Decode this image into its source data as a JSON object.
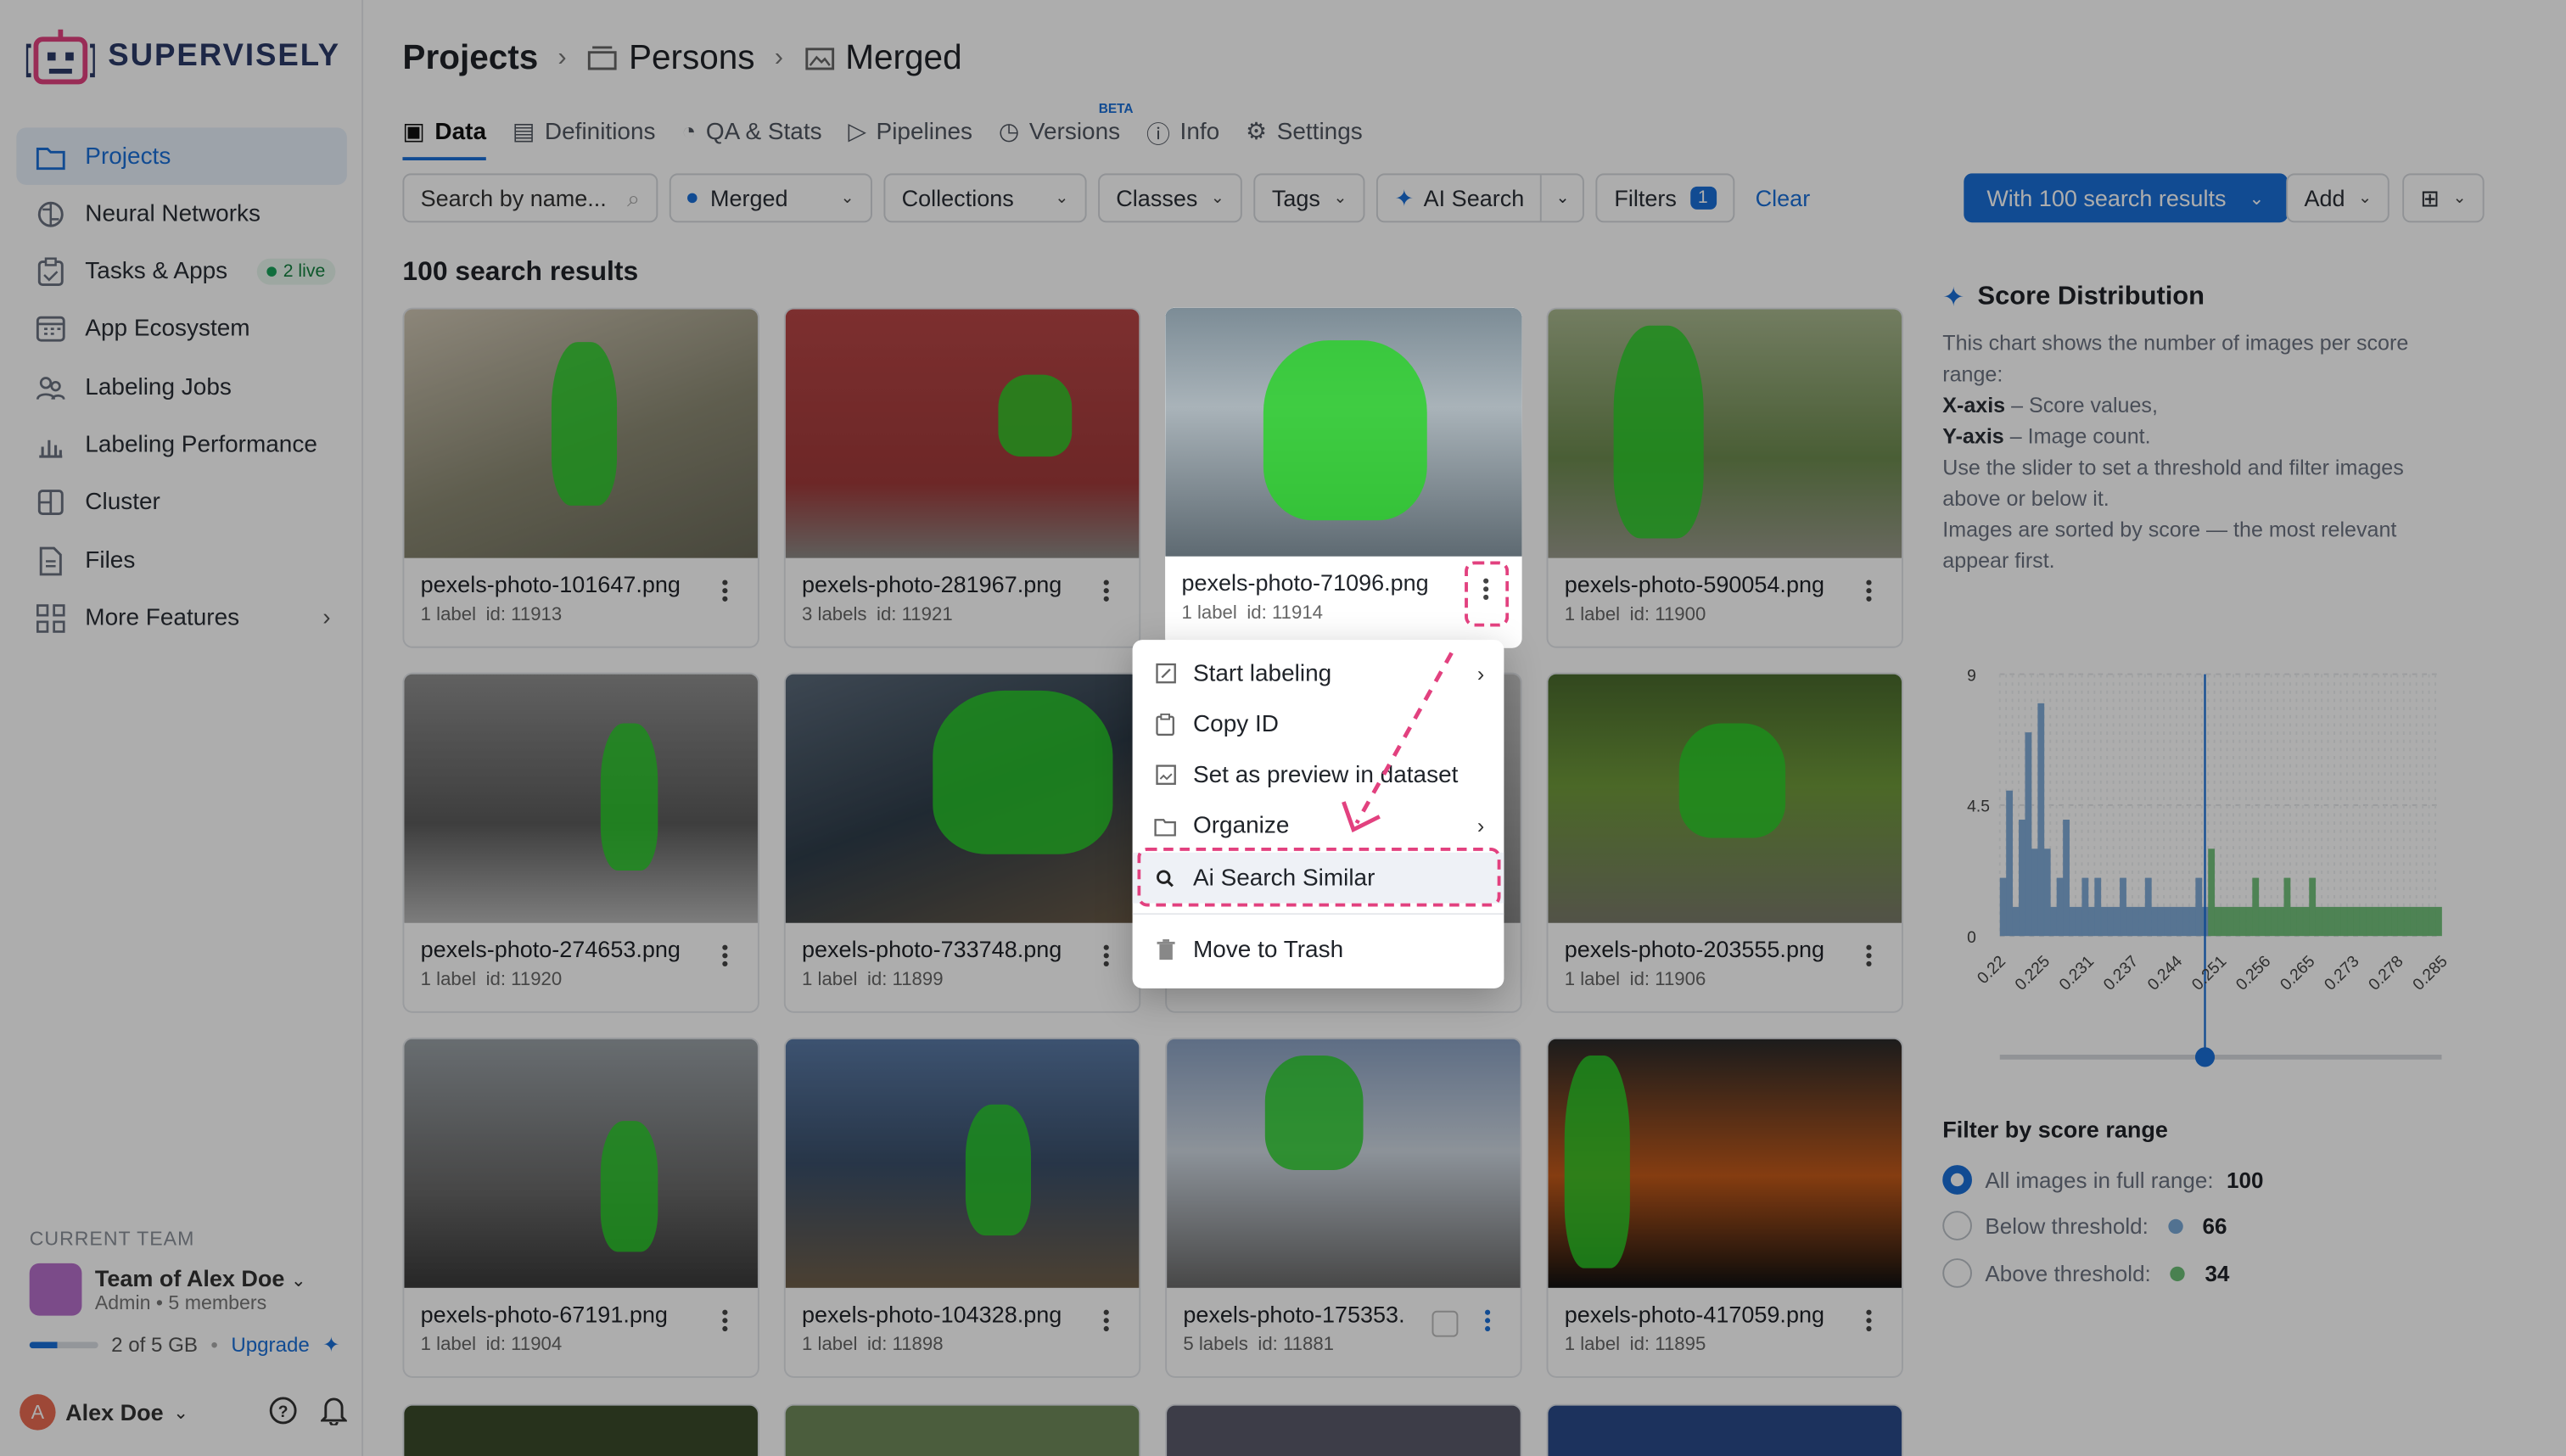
{
  "brand": {
    "name": "SUPERVISELY",
    "accent": "#1a6fd8"
  },
  "sidebar": {
    "items": [
      {
        "label": "Projects",
        "icon": "folder-icon",
        "active": true
      },
      {
        "label": "Neural Networks",
        "icon": "brain-icon"
      },
      {
        "label": "Tasks & Apps",
        "icon": "clipboard-icon",
        "badge": "2 live"
      },
      {
        "label": "App Ecosystem",
        "icon": "grid-calendar-icon"
      },
      {
        "label": "Labeling Jobs",
        "icon": "people-icon"
      },
      {
        "label": "Labeling Performance",
        "icon": "bar-chart-icon"
      },
      {
        "label": "Cluster",
        "icon": "server-icon"
      },
      {
        "label": "Files",
        "icon": "file-icon"
      },
      {
        "label": "More Features",
        "icon": "apps-icon"
      }
    ],
    "team": {
      "caption": "CURRENT TEAM",
      "name": "Team of Alex Doe",
      "role": "Admin",
      "members": "5 members",
      "storage": "2 of 5 GB",
      "storage_fraction": 0.4,
      "upgrade": "Upgrade"
    },
    "user": {
      "initial": "A",
      "name": "Alex Doe"
    }
  },
  "breadcrumb": {
    "root": "Projects",
    "project": "Persons",
    "dataset": "Merged"
  },
  "tabs": [
    {
      "label": "Data",
      "active": true
    },
    {
      "label": "Definitions"
    },
    {
      "label": "QA & Stats"
    },
    {
      "label": "Pipelines"
    },
    {
      "label": "Versions",
      "badge": "BETA"
    },
    {
      "label": "Info"
    },
    {
      "label": "Settings"
    }
  ],
  "toolbar": {
    "search_placeholder": "Search by name...",
    "dataset": "Merged",
    "collections": "Collections",
    "classes": "Classes",
    "tags": "Tags",
    "ai_search": "AI Search",
    "filters": "Filters",
    "filters_count": "1",
    "clear": "Clear",
    "primary": "With 100 search results",
    "add": "Add"
  },
  "results": {
    "title": "100 search results",
    "cards": [
      {
        "name": "pexels-photo-101647.png",
        "labels": "1 label",
        "id": "id: 11913"
      },
      {
        "name": "pexels-photo-281967.png",
        "labels": "3 labels",
        "id": "id: 11921"
      },
      {
        "name": "pexels-photo-71096.png",
        "labels": "1 label",
        "id": "id: 11914"
      },
      {
        "name": "pexels-photo-590054.png",
        "labels": "1 label",
        "id": "id: 11900"
      },
      {
        "name": "pexels-photo-274653.png",
        "labels": "1 label",
        "id": "id: 11920"
      },
      {
        "name": "pexels-photo-733748.png",
        "labels": "1 label",
        "id": "id: 11899"
      },
      {
        "name": "",
        "labels": "",
        "id": ""
      },
      {
        "name": "pexels-photo-203555.png",
        "labels": "1 label",
        "id": "id: 11906"
      },
      {
        "name": "pexels-photo-67191.png",
        "labels": "1 label",
        "id": "id: 11904"
      },
      {
        "name": "pexels-photo-104328.png",
        "labels": "1 label",
        "id": "id: 11898"
      },
      {
        "name": "pexels-photo-175353.",
        "labels": "5 labels",
        "id": "id: 11881"
      },
      {
        "name": "pexels-photo-417059.png",
        "labels": "1 label",
        "id": "id: 11895"
      }
    ]
  },
  "context_menu": {
    "items": [
      {
        "label": "Start labeling",
        "icon": "edit-icon",
        "submenu": true
      },
      {
        "label": "Copy ID",
        "icon": "clipboard-icon"
      },
      {
        "label": "Set as preview in dataset",
        "icon": "image-icon"
      },
      {
        "label": "Organize",
        "icon": "folder-icon",
        "submenu": true
      },
      {
        "label": "Ai Search Similar",
        "icon": "search-icon",
        "highlighted": true
      },
      {
        "label": "Move to Trash",
        "icon": "trash-icon"
      }
    ]
  },
  "score_panel": {
    "title": "Score Distribution",
    "desc1": "This chart shows the number of images per score range:",
    "xaxis_key": "X-axis",
    "xaxis_text": " – Score values,",
    "yaxis_key": "Y-axis",
    "yaxis_text": " – Image count.",
    "desc2": "Use the slider to set a threshold and filter images above or below it.",
    "desc3": "Images are sorted by score — the most relevant appear first.",
    "filter_title": "Filter by score range",
    "opt_all": "All images in full range:",
    "opt_all_val": "100",
    "opt_below": "Below threshold:",
    "opt_below_val": "66",
    "opt_above": "Above threshold:",
    "opt_above_val": "34",
    "below_color": "#7aa8d6",
    "above_color": "#6cbf76"
  },
  "chart_data": {
    "type": "bar",
    "xlabel": "",
    "ylabel": "",
    "ylim": [
      0,
      9
    ],
    "yticks": [
      0,
      4.5,
      9
    ],
    "xticks": [
      "0.22",
      "0.225",
      "0.231",
      "0.237",
      "0.244",
      "0.251",
      "0.256",
      "0.265",
      "0.273",
      "0.278",
      "0.285"
    ],
    "threshold": 0.2525,
    "x_range": [
      0.22,
      0.29
    ],
    "series": [
      {
        "values": [
          2,
          5,
          1,
          4,
          7,
          3,
          8,
          3,
          1,
          2,
          4,
          1,
          1,
          2,
          1,
          2,
          1,
          1,
          1,
          2,
          1,
          1,
          1,
          2,
          1,
          1,
          1,
          1,
          1,
          1,
          1,
          2,
          1,
          3,
          1,
          1,
          1,
          1,
          1,
          1,
          2,
          1,
          1,
          1,
          1,
          2,
          1,
          1,
          1,
          2,
          1,
          1,
          1,
          1,
          1,
          1,
          1,
          1,
          1,
          1,
          1,
          1,
          1,
          1,
          1,
          1,
          1,
          1,
          1,
          1
        ]
      }
    ]
  }
}
